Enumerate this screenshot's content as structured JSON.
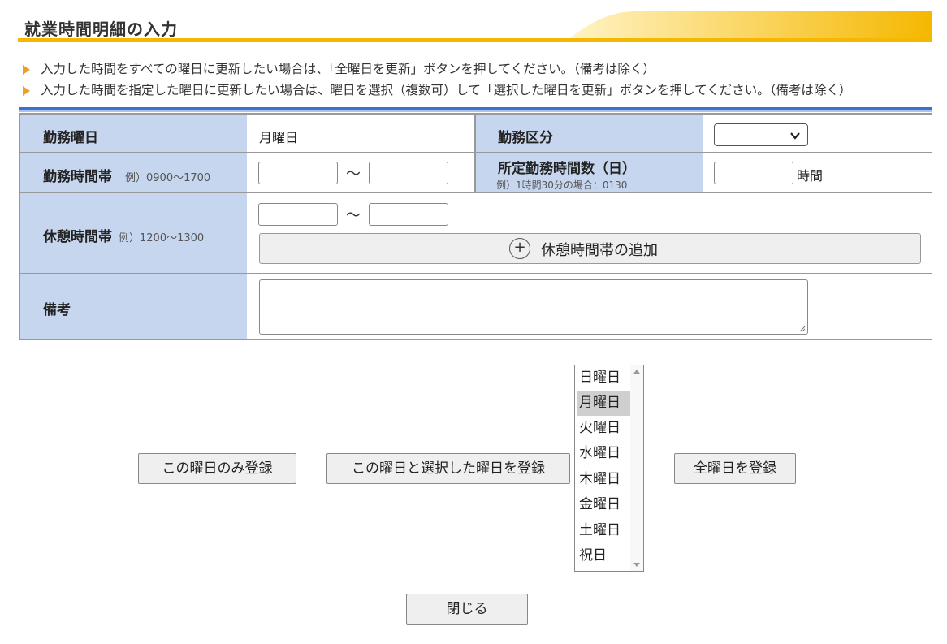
{
  "page": {
    "title": "就業時間明細の入力"
  },
  "notes": [
    "入力した時間をすべての曜日に更新したい場合は、「全曜日を更新」ボタンを押してください。（備考は除く）",
    "入力した時間を指定した曜日に更新したい場合は、曜日を選択（複数可）して「選択した曜日を更新」ボタンを押してください。（備考は除く）"
  ],
  "form": {
    "work_day": {
      "label": "勤務曜日",
      "value": "月曜日"
    },
    "work_category": {
      "label": "勤務区分",
      "selected": ""
    },
    "work_hours": {
      "label": "勤務時間帯",
      "example": "例）0900～1700",
      "start": "",
      "end": "",
      "separator": "～"
    },
    "scheduled_hours": {
      "label": "所定勤務時間数（日）",
      "example": "例）1時間30分の場合：0130",
      "value": "",
      "unit": "時間"
    },
    "break_hours": {
      "label": "休憩時間帯",
      "example": "例）1200～1300",
      "start": "",
      "end": "",
      "separator": "～",
      "add_button": "休憩時間帯の追加",
      "add_icon": "+"
    },
    "remarks": {
      "label": "備考",
      "value": ""
    }
  },
  "actions": {
    "register_this_day": "この曜日のみ登録",
    "register_selected_days": "この曜日と選択した曜日を登録",
    "register_all_days": "全曜日を登録",
    "close": "閉じる"
  },
  "day_list": {
    "options": [
      "日曜日",
      "月曜日",
      "火曜日",
      "水曜日",
      "木曜日",
      "金曜日",
      "土曜日",
      "祝日"
    ],
    "selected": "月曜日"
  },
  "colors": {
    "accent_blue": "#3b6fd0",
    "label_bg": "#c6d6ee",
    "stripe_orange": "#f5b800"
  }
}
